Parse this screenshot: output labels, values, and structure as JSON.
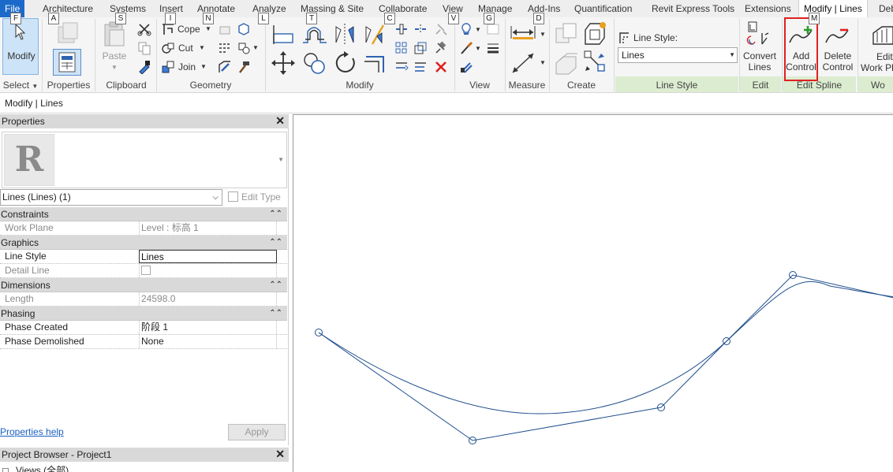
{
  "ribbon_tabs": [
    {
      "label": "File",
      "key": "F"
    },
    {
      "label": "Architecture",
      "key": "A"
    },
    {
      "label": "Systems",
      "key": "S"
    },
    {
      "label": "Insert",
      "key": "I"
    },
    {
      "label": "Annotate",
      "key": "N"
    },
    {
      "label": "Analyze",
      "key": "L"
    },
    {
      "label": "Massing & Site",
      "key": "T"
    },
    {
      "label": "Collaborate",
      "key": "C"
    },
    {
      "label": "View",
      "key": "V"
    },
    {
      "label": "Manage",
      "key": "G"
    },
    {
      "label": "Add-Ins",
      "key": "D"
    },
    {
      "label": "Quantification",
      "key": ""
    },
    {
      "label": "Revit Express Tools",
      "key": ""
    },
    {
      "label": "Extensions",
      "key": ""
    },
    {
      "label": "Modify | Lines",
      "key": "M"
    },
    {
      "label": "Deb",
      "key": ""
    }
  ],
  "ribbon": {
    "select": {
      "button": "Modify",
      "panel": "Select"
    },
    "properties": {
      "panel": "Properties"
    },
    "clipboard": {
      "paste": "Paste",
      "panel": "Clipboard"
    },
    "geometry": {
      "cope": "Cope",
      "cut": "Cut",
      "join": "Join",
      "panel": "Geometry"
    },
    "modify": {
      "panel": "Modify"
    },
    "view": {
      "panel": "View"
    },
    "measure": {
      "panel": "Measure"
    },
    "create": {
      "panel": "Create"
    },
    "line_style": {
      "label": "Line Style:",
      "value": "Lines",
      "panel": "Line Style"
    },
    "edit": {
      "convert_line1": "Convert",
      "convert_line2": "Lines",
      "panel": "Edit"
    },
    "edit_spline": {
      "add_line1": "Add",
      "add_line2": "Control",
      "delete_line1": "Delete",
      "delete_line2": "Control",
      "panel": "Edit Spline"
    },
    "work_plane": {
      "edit_line1": "Edit",
      "edit_line2": "Work Pl",
      "panel": "Wo"
    }
  },
  "context_label": "Modify | Lines",
  "properties": {
    "title": "Properties",
    "type_selector": "Lines (Lines) (1)",
    "edit_type": "Edit Type",
    "categories": [
      {
        "name": "Constraints",
        "rows": [
          {
            "name": "Work Plane",
            "value": "Level : 标高 1",
            "readonly": true
          }
        ]
      },
      {
        "name": "Graphics",
        "rows": [
          {
            "name": "Line Style",
            "value": "Lines",
            "editing": true
          },
          {
            "name": "Detail Line",
            "value": "",
            "checkbox": true,
            "readonly": true
          }
        ]
      },
      {
        "name": "Dimensions",
        "rows": [
          {
            "name": "Length",
            "value": "24598.0",
            "readonly": true
          }
        ]
      },
      {
        "name": "Phasing",
        "rows": [
          {
            "name": "Phase Created",
            "value": "阶段 1"
          },
          {
            "name": "Phase Demolished",
            "value": "None"
          }
        ]
      }
    ],
    "help_link": "Properties help",
    "apply": "Apply"
  },
  "project_browser": {
    "title": "Project Browser - Project1",
    "root": "Views (全部)"
  },
  "colors": {
    "accent": "#1b6ac9",
    "spline": "#1f4e8c",
    "highlight": "#e02020",
    "green": "#2a9a2a"
  }
}
